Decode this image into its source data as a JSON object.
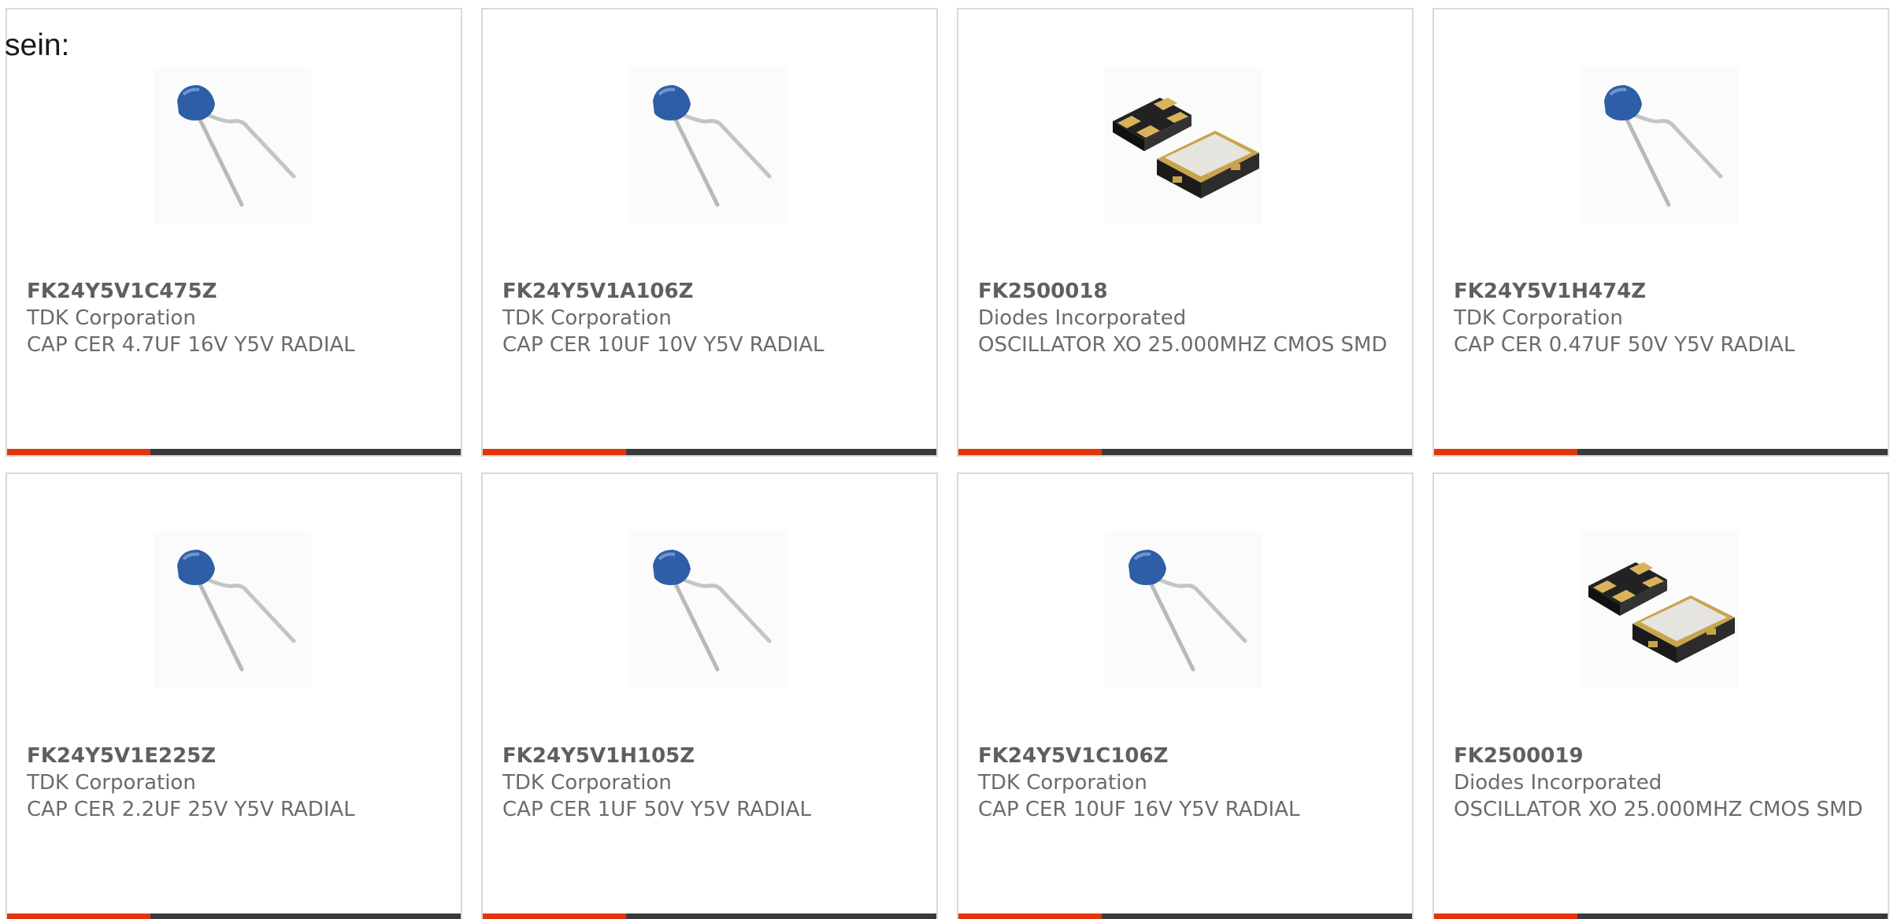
{
  "intro_text": "sein:",
  "colors": {
    "accent": "#e2360a",
    "bar": "#3a3a3a",
    "card_border": "#d9d9d9",
    "text": "#6b6b6b"
  },
  "products": [
    {
      "part": "FK24Y5V1C475Z",
      "manufacturer": "TDK Corporation",
      "description": "CAP CER 4.7UF 16V Y5V RADIAL",
      "image_icon": "radial-capacitor-icon"
    },
    {
      "part": "FK24Y5V1A106Z",
      "manufacturer": "TDK Corporation",
      "description": "CAP CER 10UF 10V Y5V RADIAL",
      "image_icon": "radial-capacitor-icon"
    },
    {
      "part": "FK2500018",
      "manufacturer": "Diodes Incorporated",
      "description": "OSCILLATOR XO 25.000MHZ CMOS SMD",
      "image_icon": "smd-oscillator-icon"
    },
    {
      "part": "FK24Y5V1H474Z",
      "manufacturer": "TDK Corporation",
      "description": "CAP CER 0.47UF 50V Y5V RADIAL",
      "image_icon": "radial-capacitor-icon"
    },
    {
      "part": "FK24Y5V1E225Z",
      "manufacturer": "TDK Corporation",
      "description": "CAP CER 2.2UF 25V Y5V RADIAL",
      "image_icon": "radial-capacitor-icon"
    },
    {
      "part": "FK24Y5V1H105Z",
      "manufacturer": "TDK Corporation",
      "description": "CAP CER 1UF 50V Y5V RADIAL",
      "image_icon": "radial-capacitor-icon"
    },
    {
      "part": "FK24Y5V1C106Z",
      "manufacturer": "TDK Corporation",
      "description": "CAP CER 10UF 16V Y5V RADIAL",
      "image_icon": "radial-capacitor-icon"
    },
    {
      "part": "FK2500019",
      "manufacturer": "Diodes Incorporated",
      "description": "OSCILLATOR XO 25.000MHZ CMOS SMD",
      "image_icon": "smd-oscillator-icon"
    }
  ]
}
